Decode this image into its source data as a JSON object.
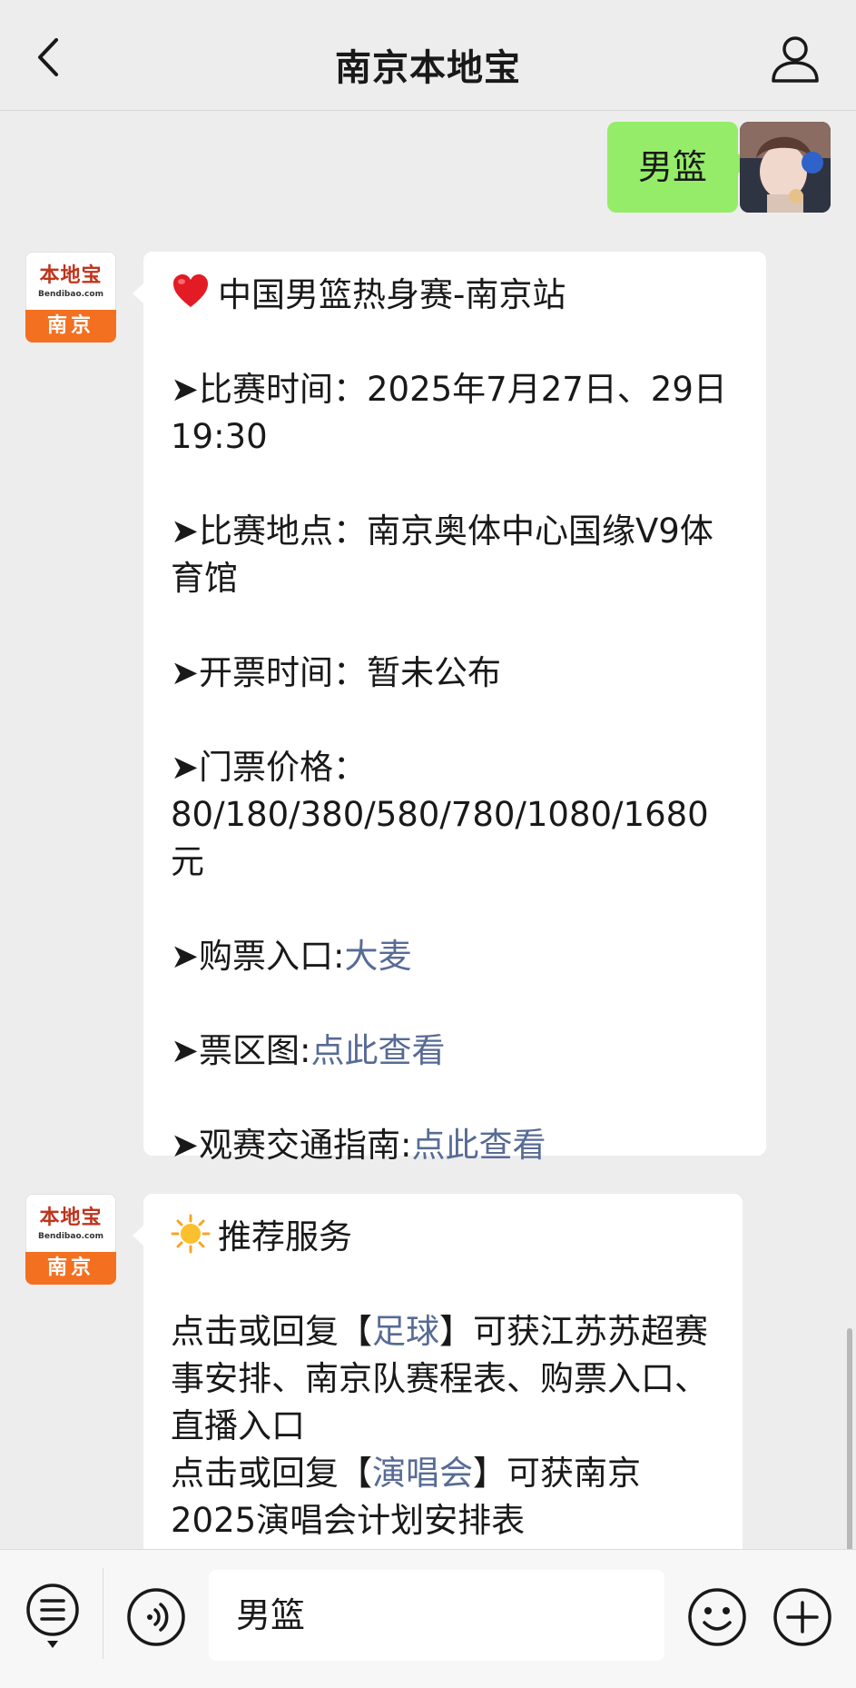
{
  "header": {
    "title": "南京本地宝"
  },
  "outgoing": {
    "text": "男篮"
  },
  "bot": {
    "logo_cn": "本地宝",
    "logo_en": "Bendibao.com",
    "logo_city": "南京"
  },
  "message1": {
    "title": "中国男篮热身赛-南京站",
    "match_time": "➤比赛时间：2025年7月27日、29日 19:30",
    "venue": "➤比赛地点：南京奥体中心国缘V9体育馆",
    "sale_time": "➤开票时间：暂未公布",
    "price": "➤门票价格：80/180/380/580/780/1080/1680元",
    "ticket_label": "➤购票入口:",
    "ticket_link": "大麦",
    "seat_label": "➤票区图:",
    "seat_link": "点此查看",
    "transport_label": "➤观赛交通指南:",
    "transport_link": "点此查看"
  },
  "message2": {
    "title": "推荐服务",
    "line1_pre": "点击或回复【",
    "line1_link": "足球",
    "line1_post": "】可获江苏苏超赛事安排、南京队赛程表、购票入口、直播入口",
    "line2_pre": "点击或回复【",
    "line2_link": "演唱会",
    "line2_post": "】可获南京2025演唱会计划安排表"
  },
  "input": {
    "value": "男篮"
  },
  "icons": {
    "back": "chevron-left-icon",
    "profile": "person-icon",
    "menu": "menu-list-icon",
    "voice": "voice-icon",
    "emoji": "emoji-icon",
    "plus": "plus-icon",
    "heart": "heart-icon",
    "sun": "sun-icon"
  },
  "colors": {
    "bubble_out": "#95ec69",
    "link": "#576b95",
    "brand_orange": "#f37021"
  }
}
